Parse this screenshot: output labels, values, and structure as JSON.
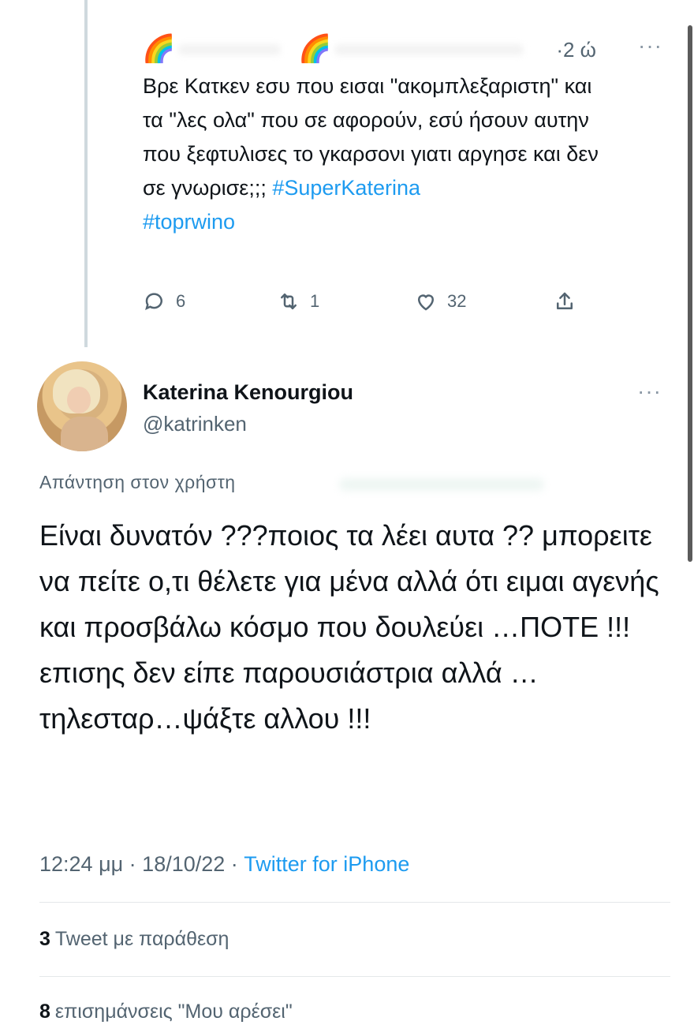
{
  "parent_tweet": {
    "avatar_emoji": "🌈",
    "name_emoji": "🌈",
    "time": "·2 ώ",
    "more_icon": "more-horizontal-icon",
    "text_plain": "Βρε Κατκεν εσυ που εισαι \"ακομπλεξαριστη\" και τα \"λες ολα\" που σε αφορούν, εσύ ήσουν αυτην που ξεφτυλισες το γκαρσονι γιατι αργησε και δεν σε γνωρισε;;; ",
    "hashtags": [
      "#SuperKaterina",
      "#toprwino"
    ],
    "actions": {
      "replies": "6",
      "retweets": "1",
      "likes": "32"
    }
  },
  "main_tweet": {
    "author_name": "Katerina Kenourgiou",
    "author_handle": "@katrinken",
    "reply_to_label": "Απάντηση στον χρήστη",
    "text": "Είναι δυνατόν ???ποιος τα λέει αυτα ?? μπορειτε να πείτε ο,τι θέλετε για μένα αλλά ότι ειμαι αγενής και προσβάλω κόσμο που δουλεύει …ΠΟΤΕ !!!επισης δεν είπε παρουσιάστρια αλλά … τηλεσταρ…ψάξτε αλλου !!!",
    "time": "12:24 μμ · 18/10/22 · ",
    "source": "Twitter for iPhone"
  },
  "stats": {
    "quote_count": "3",
    "quote_label": "Tweet με παράθεση",
    "like_count": "8",
    "like_label": "επισημάνσεις \"Μου αρέσει\""
  },
  "colors": {
    "link": "#1d9bf0",
    "secondary_text": "#536471",
    "primary_text": "#0f1419"
  }
}
